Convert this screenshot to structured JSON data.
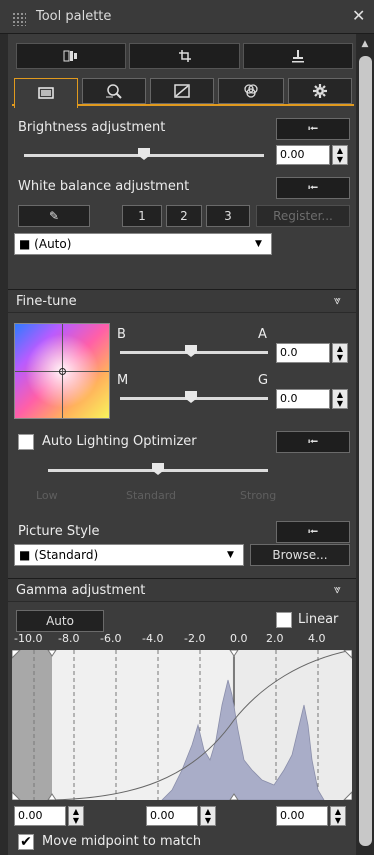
{
  "window": {
    "title": "Tool palette",
    "close_glyph": "✕"
  },
  "toolbar": {
    "icons": [
      "compare-icon",
      "crop-icon",
      "stamp-icon"
    ]
  },
  "tabs": [
    {
      "icon": "basic-adjustment-icon",
      "glyph": "▣"
    },
    {
      "icon": "lens-correction-icon",
      "glyph": "◎"
    },
    {
      "icon": "tone-curve-icon",
      "glyph": "◩"
    },
    {
      "icon": "color-adjustment-icon",
      "glyph": "◍"
    },
    {
      "icon": "settings-gear-icon",
      "glyph": "✹"
    }
  ],
  "brightness": {
    "label": "Brightness adjustment",
    "value": "0.00",
    "level": 0.5
  },
  "white_balance": {
    "label": "White balance adjustment",
    "presets": [
      "1",
      "2",
      "3"
    ],
    "register_label": "Register...",
    "selected": "(Auto)"
  },
  "fine_tune": {
    "label": "Fine-tune",
    "b_label": "B",
    "a_label": "A",
    "m_label": "M",
    "g_label": "G",
    "ba_value": "0.0",
    "mg_value": "0.0"
  },
  "alo": {
    "label": "Auto Lighting Optimizer",
    "levels": [
      "Low",
      "Standard",
      "Strong"
    ],
    "checked": false
  },
  "picture_style": {
    "label": "Picture Style",
    "selected": "(Standard)",
    "browse_label": "Browse..."
  },
  "gamma": {
    "label": "Gamma adjustment",
    "auto_label": "Auto",
    "linear_label": "Linear",
    "scale": [
      "-10.0",
      "-8.0",
      "-6.0",
      "-4.0",
      "-2.0",
      "0.0",
      "2.0",
      "4.0"
    ],
    "left_value": "0.00",
    "mid_value": "0.00",
    "right_value": "0.00",
    "move_midpoint_label": "Move midpoint to match",
    "move_midpoint_checked": true
  },
  "colors": {
    "accent": "#e19a1e",
    "panel": "#3c3c3c",
    "histogram": "#a9adc8"
  }
}
